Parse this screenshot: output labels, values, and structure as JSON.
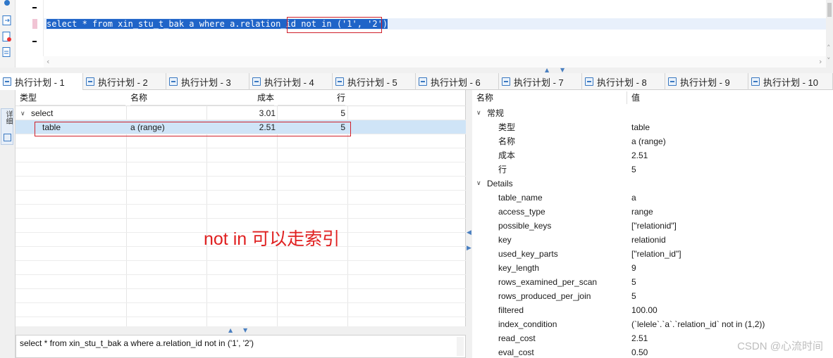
{
  "editor": {
    "sql_part1": "select * from xin_stu_t_bak a where a.relation_id",
    "sql_part2": " not in ('1', '2')",
    "sql_part3": ""
  },
  "tabs": [
    {
      "label": "执行计划 - 1"
    },
    {
      "label": "执行计划 - 2"
    },
    {
      "label": "执行计划 - 3"
    },
    {
      "label": "执行计划 - 4"
    },
    {
      "label": "执行计划 - 5"
    },
    {
      "label": "执行计划 - 6"
    },
    {
      "label": "执行计划 - 7"
    },
    {
      "label": "执行计划 - 8"
    },
    {
      "label": "执行计划 - 9"
    },
    {
      "label": "执行计划 - 10"
    }
  ],
  "side_panel": {
    "label": "详细"
  },
  "grid": {
    "columns": [
      "类型",
      "名称",
      "成本",
      "行"
    ],
    "rows": [
      {
        "type": "select",
        "name": "",
        "cost": "3.01",
        "rows": "5"
      },
      {
        "type": "table",
        "name": "a (range)",
        "cost": "2.51",
        "rows": "5"
      }
    ]
  },
  "annotation": "not in 可以走索引",
  "sql_preview": "select * from xin_stu_t_bak a where a.relation_id not in ('1', '2')",
  "properties": {
    "header_name": "名称",
    "header_value": "值",
    "sections": {
      "general": {
        "title": "常规",
        "items": [
          {
            "name": "类型",
            "value": "table"
          },
          {
            "name": "名称",
            "value": "a (range)"
          },
          {
            "name": "成本",
            "value": "2.51"
          },
          {
            "name": "行",
            "value": "5"
          }
        ]
      },
      "details": {
        "title": "Details",
        "items": [
          {
            "name": "table_name",
            "value": "a"
          },
          {
            "name": "access_type",
            "value": "range"
          },
          {
            "name": "possible_keys",
            "value": "[\"relationid\"]"
          },
          {
            "name": "key",
            "value": "relationid"
          },
          {
            "name": "used_key_parts",
            "value": "[\"relation_id\"]"
          },
          {
            "name": "key_length",
            "value": "9"
          },
          {
            "name": "rows_examined_per_scan",
            "value": "5"
          },
          {
            "name": "rows_produced_per_join",
            "value": "5"
          },
          {
            "name": "filtered",
            "value": "100.00"
          },
          {
            "name": "index_condition",
            "value": "(`lelele`.`a`.`relation_id` not in (1,2))"
          },
          {
            "name": "read_cost",
            "value": "2.51"
          },
          {
            "name": "eval_cost",
            "value": "0.50"
          }
        ]
      }
    }
  },
  "watermark": "CSDN @心流时间",
  "colors": {
    "selection": "#1f64c8",
    "highlight_box": "#d0202a",
    "annotation": "#e02020",
    "selected_row": "#cfe4f7"
  }
}
